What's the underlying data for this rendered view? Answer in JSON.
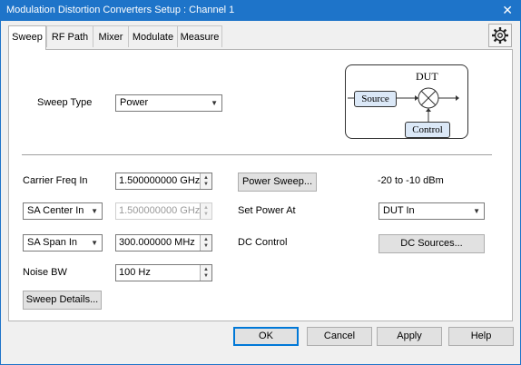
{
  "window": {
    "title": "Modulation Distortion Converters Setup : Channel 1"
  },
  "tabs": [
    {
      "label": "Sweep"
    },
    {
      "label": "RF Path"
    },
    {
      "label": "Mixer"
    },
    {
      "label": "Modulate"
    },
    {
      "label": "Measure"
    }
  ],
  "sweep": {
    "sweep_type_label": "Sweep Type",
    "sweep_type_value": "Power",
    "diagram": {
      "dut": "DUT",
      "source": "Source",
      "control": "Control"
    },
    "carrier_freq_label": "Carrier Freq In",
    "carrier_freq_value": "1.500000000 GHz",
    "sa_center_select": "SA Center In",
    "sa_center_value": "1.500000000 GHz",
    "sa_span_select": "SA Span In",
    "sa_span_value": "300.000000 MHz",
    "noise_bw_label": "Noise BW",
    "noise_bw_value": "100 Hz",
    "sweep_details_button": "Sweep Details...",
    "power_sweep_button": "Power Sweep...",
    "power_range": "-20 to -10 dBm",
    "set_power_at_label": "Set Power At",
    "set_power_at_value": "DUT In",
    "dc_control_label": "DC Control",
    "dc_sources_button": "DC Sources..."
  },
  "footer": {
    "ok": "OK",
    "cancel": "Cancel",
    "apply": "Apply",
    "help": "Help"
  },
  "colors": {
    "titlebar": "#1e74c9",
    "default_button_border": "#0078d7",
    "diagram_box": "#dbe8f7"
  }
}
